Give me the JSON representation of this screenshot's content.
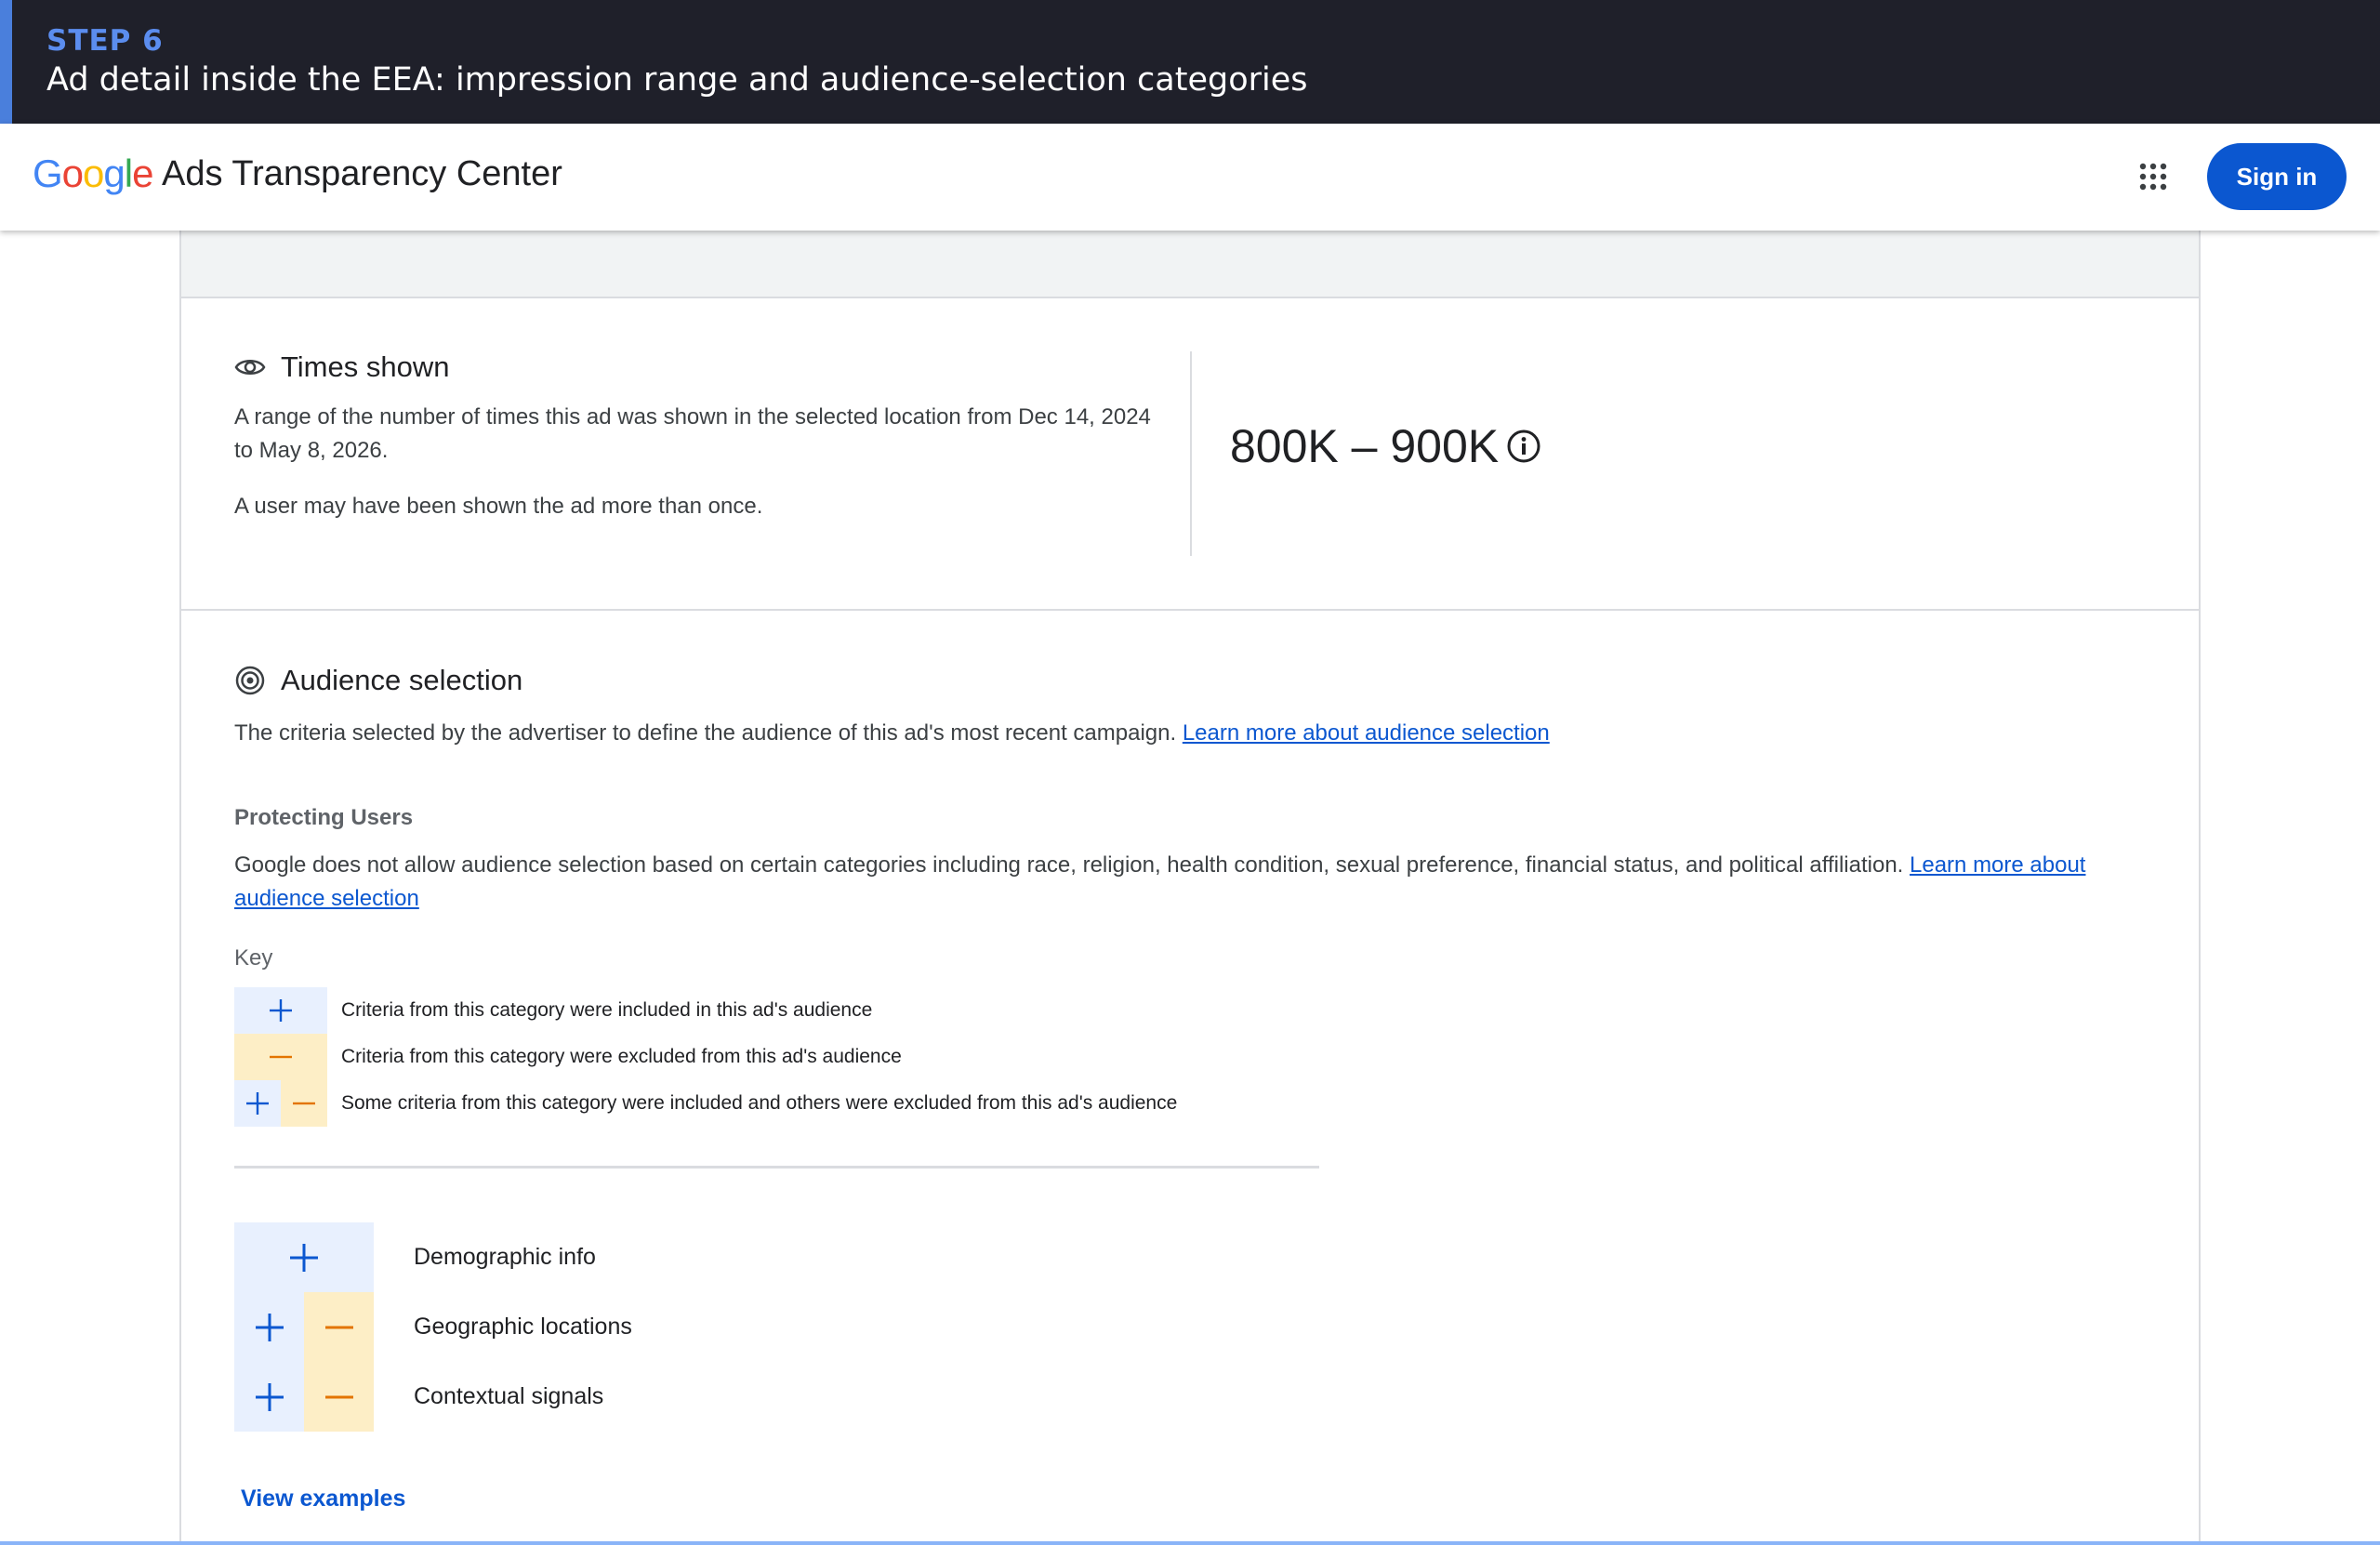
{
  "banner": {
    "step": "STEP 6",
    "title": "Ad detail inside the EEA: impression range and audience-selection categories"
  },
  "header": {
    "logo": [
      "G",
      "o",
      "o",
      "g",
      "l",
      "e"
    ],
    "logo_colors": [
      "#4285F4",
      "#EA4335",
      "#FBBC05",
      "#4285F4",
      "#34A853",
      "#EA4335"
    ],
    "product": "Ads Transparency Center",
    "apps_icon": "apps-grid-icon",
    "sign_in": "Sign in"
  },
  "times_shown": {
    "title": "Times shown",
    "icon": "eye-icon",
    "desc1": "A range of the number of times this ad was shown in the selected location from Dec 14, 2024 to May 8, 2026.",
    "desc2": "A user may have been shown the ad more than once.",
    "range": "800K – 900K",
    "info_icon": "info-icon"
  },
  "audience": {
    "title": "Audience selection",
    "icon": "target-icon",
    "desc": "The criteria selected by the advertiser to define the audience of this ad's most recent campaign. ",
    "desc_link": "Learn more about audience selection",
    "protecting_title": "Protecting Users",
    "protecting_desc": "Google does not allow audience selection based on certain categories including race, religion, health condition, sexual preference, financial status, and political affiliation. ",
    "protecting_link": "Learn more about audience selection",
    "key_label": "Key",
    "key": [
      {
        "type": "included",
        "text": "Criteria from this category were included in this ad's audience"
      },
      {
        "type": "excluded",
        "text": "Criteria from this category were excluded from this ad's audience"
      },
      {
        "type": "mixed",
        "text": "Some criteria from this category were included and others were excluded from this ad's audience"
      }
    ],
    "categories": [
      {
        "type": "included",
        "label": "Demographic info"
      },
      {
        "type": "mixed",
        "label": "Geographic locations"
      },
      {
        "type": "mixed",
        "label": "Contextual signals"
      }
    ],
    "view_examples": "View examples"
  },
  "colors": {
    "plus": "#0b57d0",
    "minus": "#e37400",
    "accent": "#0b57d0"
  }
}
